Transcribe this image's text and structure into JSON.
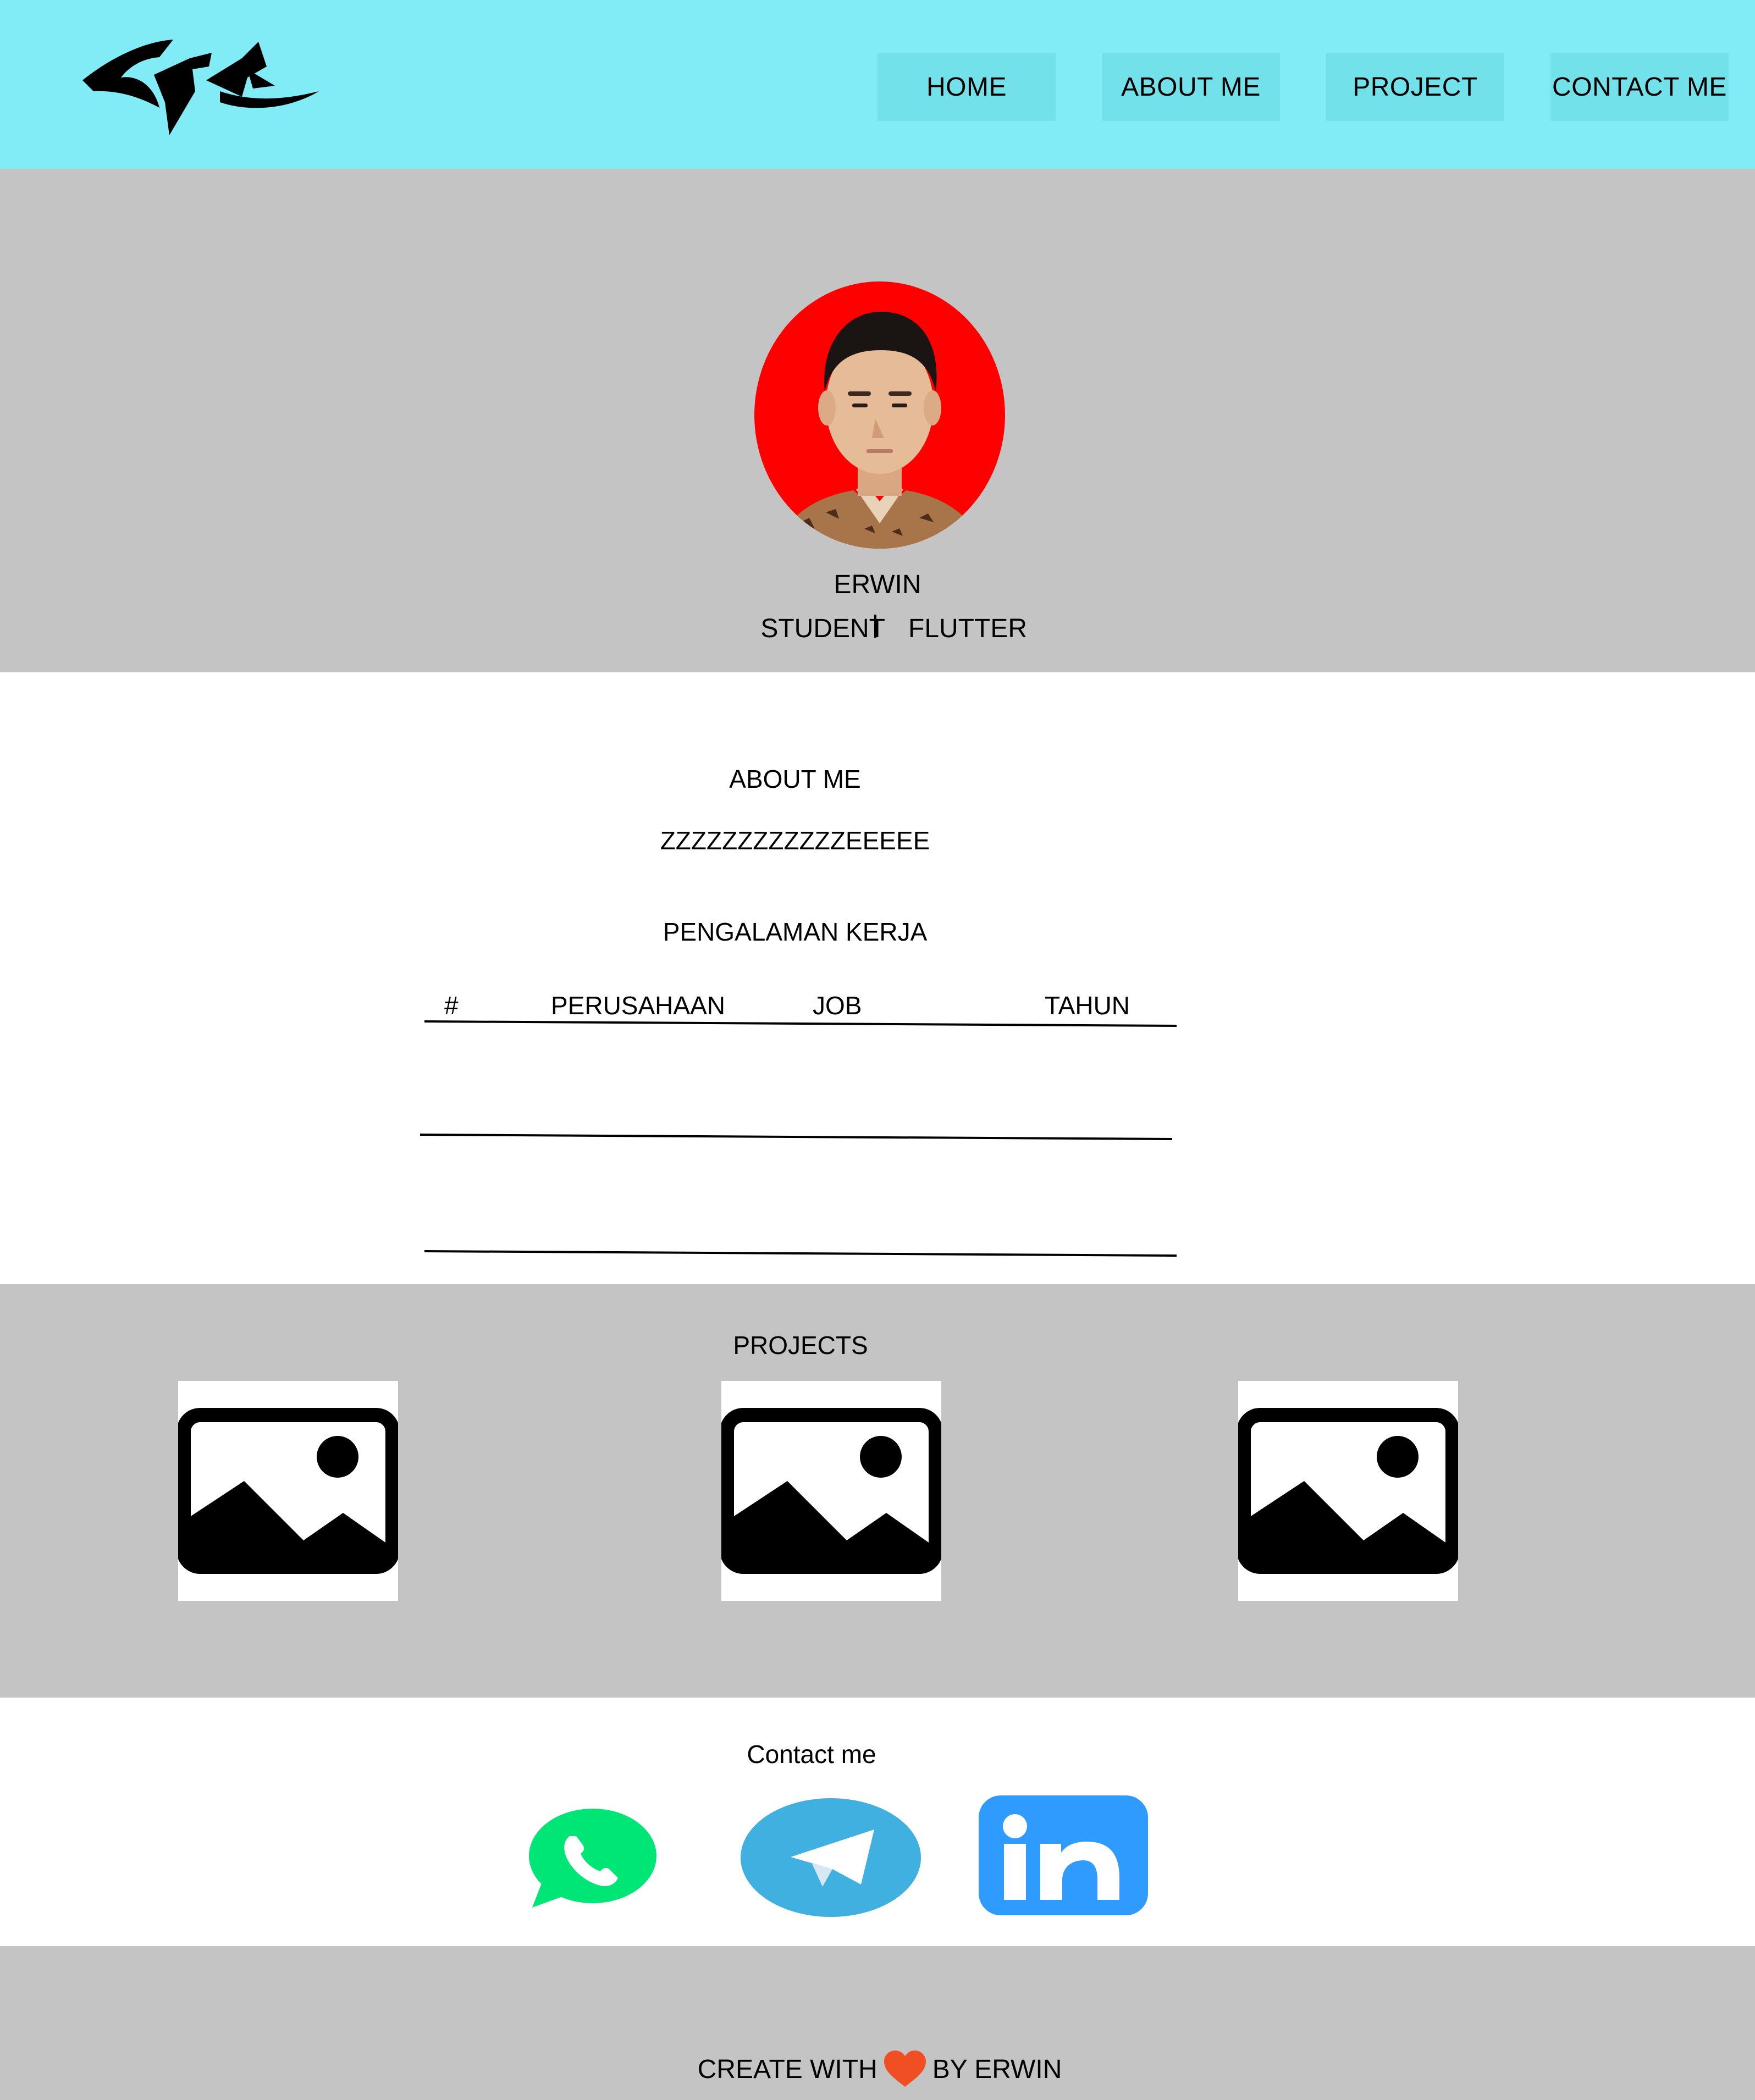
{
  "nav": {
    "items": [
      {
        "label": "HOME"
      },
      {
        "label": "ABOUT ME"
      },
      {
        "label": "PROJECT"
      },
      {
        "label": "CONTACT ME"
      }
    ]
  },
  "hero": {
    "name": "ERWIN",
    "role_left": "STUDENT",
    "role_right": "FLUTTER"
  },
  "about": {
    "title": "ABOUT ME",
    "text": "ZZZZZZZZZZZZEEEEE",
    "experience_title": "PENGALAMAN KERJA",
    "table_headers": [
      "#",
      "PERUSAHAAN",
      "JOB",
      "TAHUN"
    ]
  },
  "projects": {
    "title": "PROJECTS",
    "items": [
      {
        "icon": "image-placeholder-icon"
      },
      {
        "icon": "image-placeholder-icon"
      },
      {
        "icon": "image-placeholder-icon"
      }
    ]
  },
  "contact": {
    "title": "Contact me",
    "socials": [
      {
        "icon": "whatsapp-icon",
        "color": "#00e676"
      },
      {
        "icon": "telegram-icon",
        "color": "#3fb0e0"
      },
      {
        "icon": "linkedin-icon",
        "color": "#2f9bff"
      }
    ]
  },
  "footer": {
    "text_before": "CREATE WITH",
    "heart_icon": "heart-icon",
    "heart_color": "#f04e23",
    "text_after": "BY ERWIN"
  },
  "colors": {
    "header_bg": "#81ecf5",
    "nav_button_bg": "#73e1e9",
    "section_gray": "#c4c4c4",
    "avatar_bg": "#ff0000"
  }
}
